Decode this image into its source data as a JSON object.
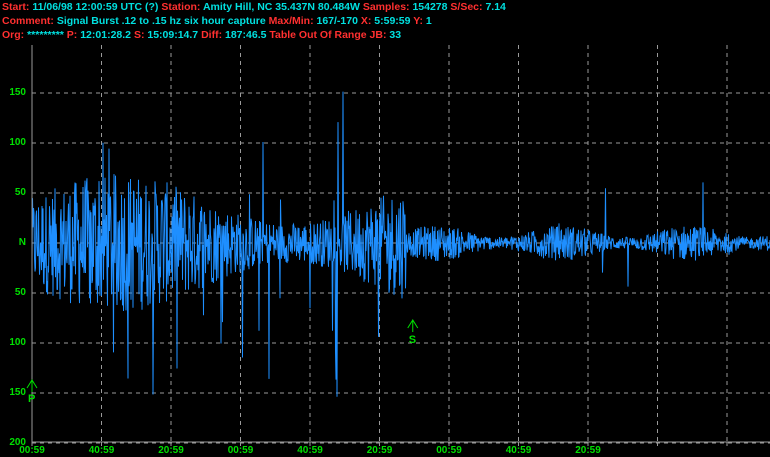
{
  "header": {
    "line1": {
      "start_label": "Start:",
      "start_value": "11/06/98 12:00:59 UTC (?)",
      "station_label": "Station:",
      "station_value": "Amity Hill, NC 35.437N 80.484W",
      "samples_label": "Samples:",
      "samples_value": "154278",
      "sps_label": "S/Sec:",
      "sps_value": "7.14"
    },
    "line2": {
      "comment_label": "Comment:",
      "comment_value": "Signal Burst .12 to .15 hz  six hour capture",
      "maxmin_label": "Max/Min:",
      "maxmin_value": "167/-170",
      "x_label": "X:",
      "x_value": "5:59:59",
      "y_label": "Y:",
      "y_value": "1"
    },
    "line3": {
      "org_label": "Org:",
      "org_value": "*********",
      "p_label": "P:",
      "p_value": "12:01:28.2",
      "s_label": "S:",
      "s_value": "15:09:14.7",
      "diff_label": "Diff:",
      "diff_value": "187:46.5",
      "range_label": "Table Out Of Range",
      "jb_label": "JB:",
      "jb_value": "33"
    }
  },
  "colors": {
    "trace": "#1e8fff",
    "grid": "#9a9a9a",
    "axis_text": "#00e000",
    "label": "#ff3030",
    "value": "#00e0e0"
  },
  "markers": {
    "p": "P",
    "s": "S"
  },
  "chart_data": {
    "type": "line",
    "y_tick_labels": [
      "150",
      "100",
      "50",
      "N",
      "50",
      "100",
      "150",
      "200"
    ],
    "y_tick_values": [
      150,
      100,
      50,
      0,
      -50,
      -100,
      -150,
      -200
    ],
    "x_tick_labels": [
      "00:59",
      "40:59",
      "20:59",
      "00:59",
      "40:59",
      "20:59",
      "00:59",
      "40:59",
      "20:59"
    ],
    "ylim": [
      -200,
      200
    ],
    "grid": true,
    "p_pick_fraction": 0.0,
    "s_pick_fraction": 0.52
  }
}
